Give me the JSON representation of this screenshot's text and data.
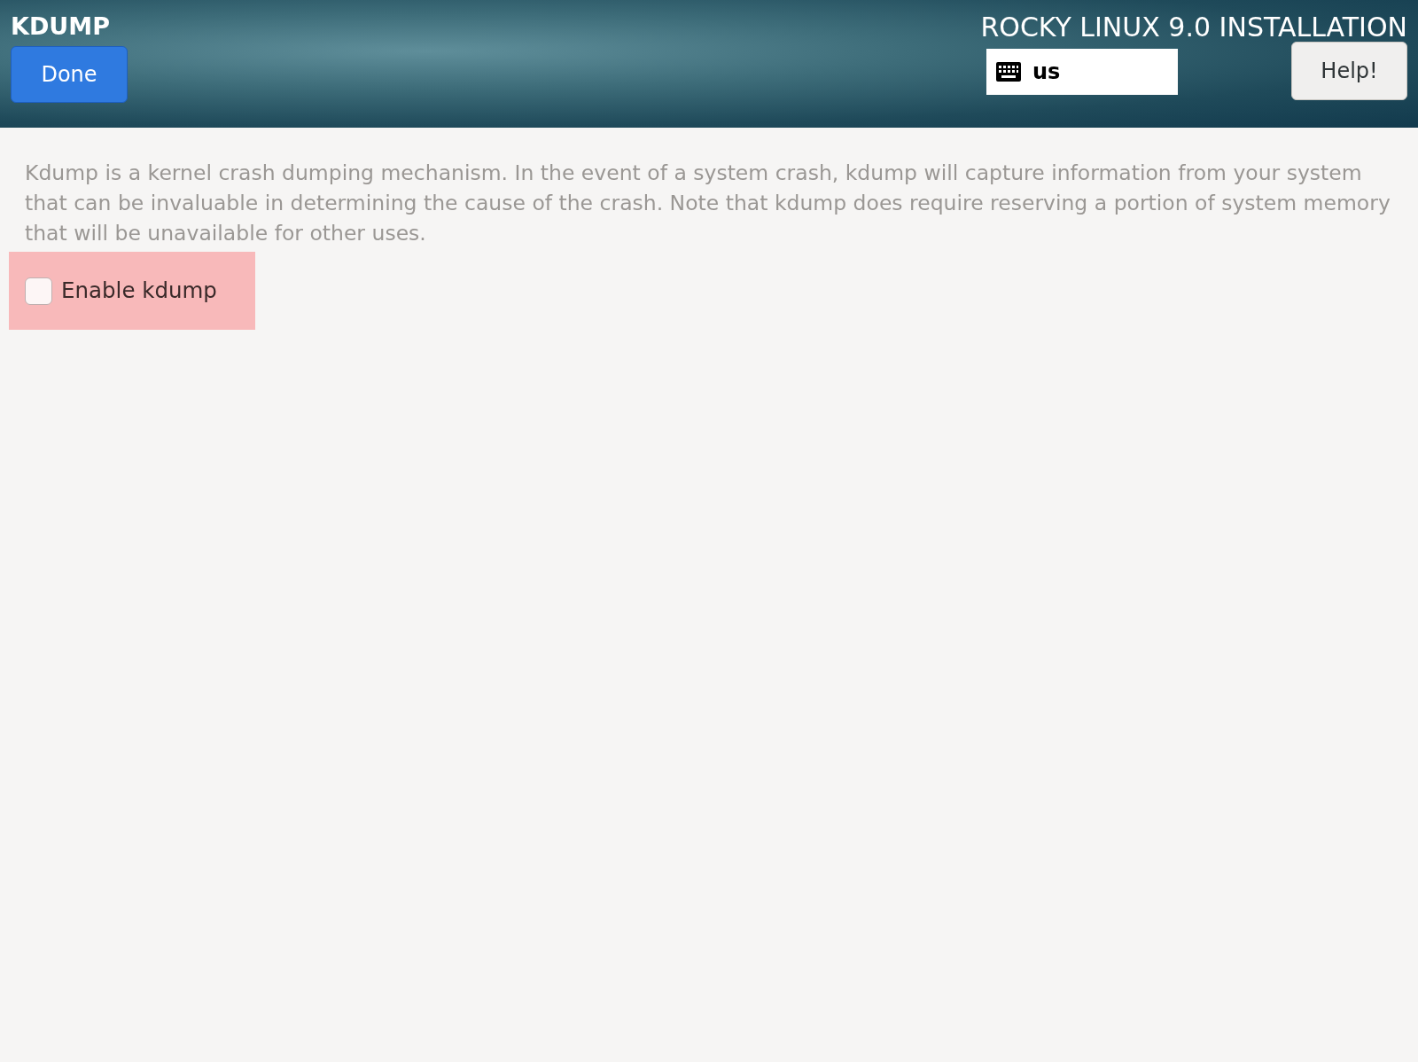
{
  "header": {
    "title": "KDUMP",
    "done_button": "Done",
    "product_title": "ROCKY LINUX 9.0 INSTALLATION",
    "keyboard_layout": "us",
    "help_button": "Help!"
  },
  "description": "Kdump is a kernel crash dumping mechanism. In the event of a system crash, kdump will capture information from your system that can be invaluable in determining the cause of the crash. Note that kdump does require reserving a portion of system memory that will be unavailable for other uses.",
  "enable_kdump": {
    "label": "Enable kdump",
    "checked": false
  }
}
